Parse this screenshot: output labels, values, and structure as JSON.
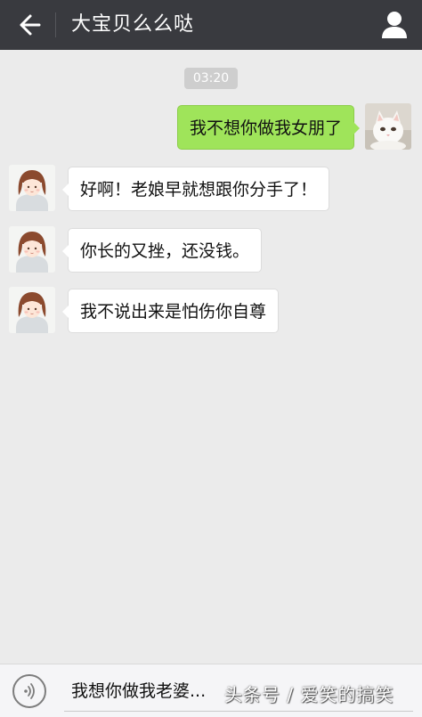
{
  "header": {
    "title": "大宝贝么么哒",
    "back_icon": "arrow-left-icon",
    "profile_icon": "person-icon"
  },
  "chat": {
    "timestamp": "03:20",
    "messages": [
      {
        "direction": "outgoing",
        "sender_avatar": "white-cat-photo",
        "text": "我不想你做我女朋了"
      },
      {
        "direction": "incoming",
        "sender_avatar": "girl-illustration",
        "text": "好啊！老娘早就想跟你分手了！"
      },
      {
        "direction": "incoming",
        "sender_avatar": "girl-illustration",
        "text": "你长的又挫，还没钱。"
      },
      {
        "direction": "incoming",
        "sender_avatar": "girl-illustration",
        "text": "我不说出来是怕伤你自尊"
      }
    ]
  },
  "input_bar": {
    "voice_icon": "voice-icon",
    "text": "我想你做我老婆..."
  },
  "watermark": {
    "text": "头条号 / 爱笑的搞笑"
  },
  "colors": {
    "header_bg": "#393a3f",
    "chat_bg": "#ebebeb",
    "outgoing_bubble": "#9fe45a",
    "incoming_bubble": "#ffffff"
  }
}
